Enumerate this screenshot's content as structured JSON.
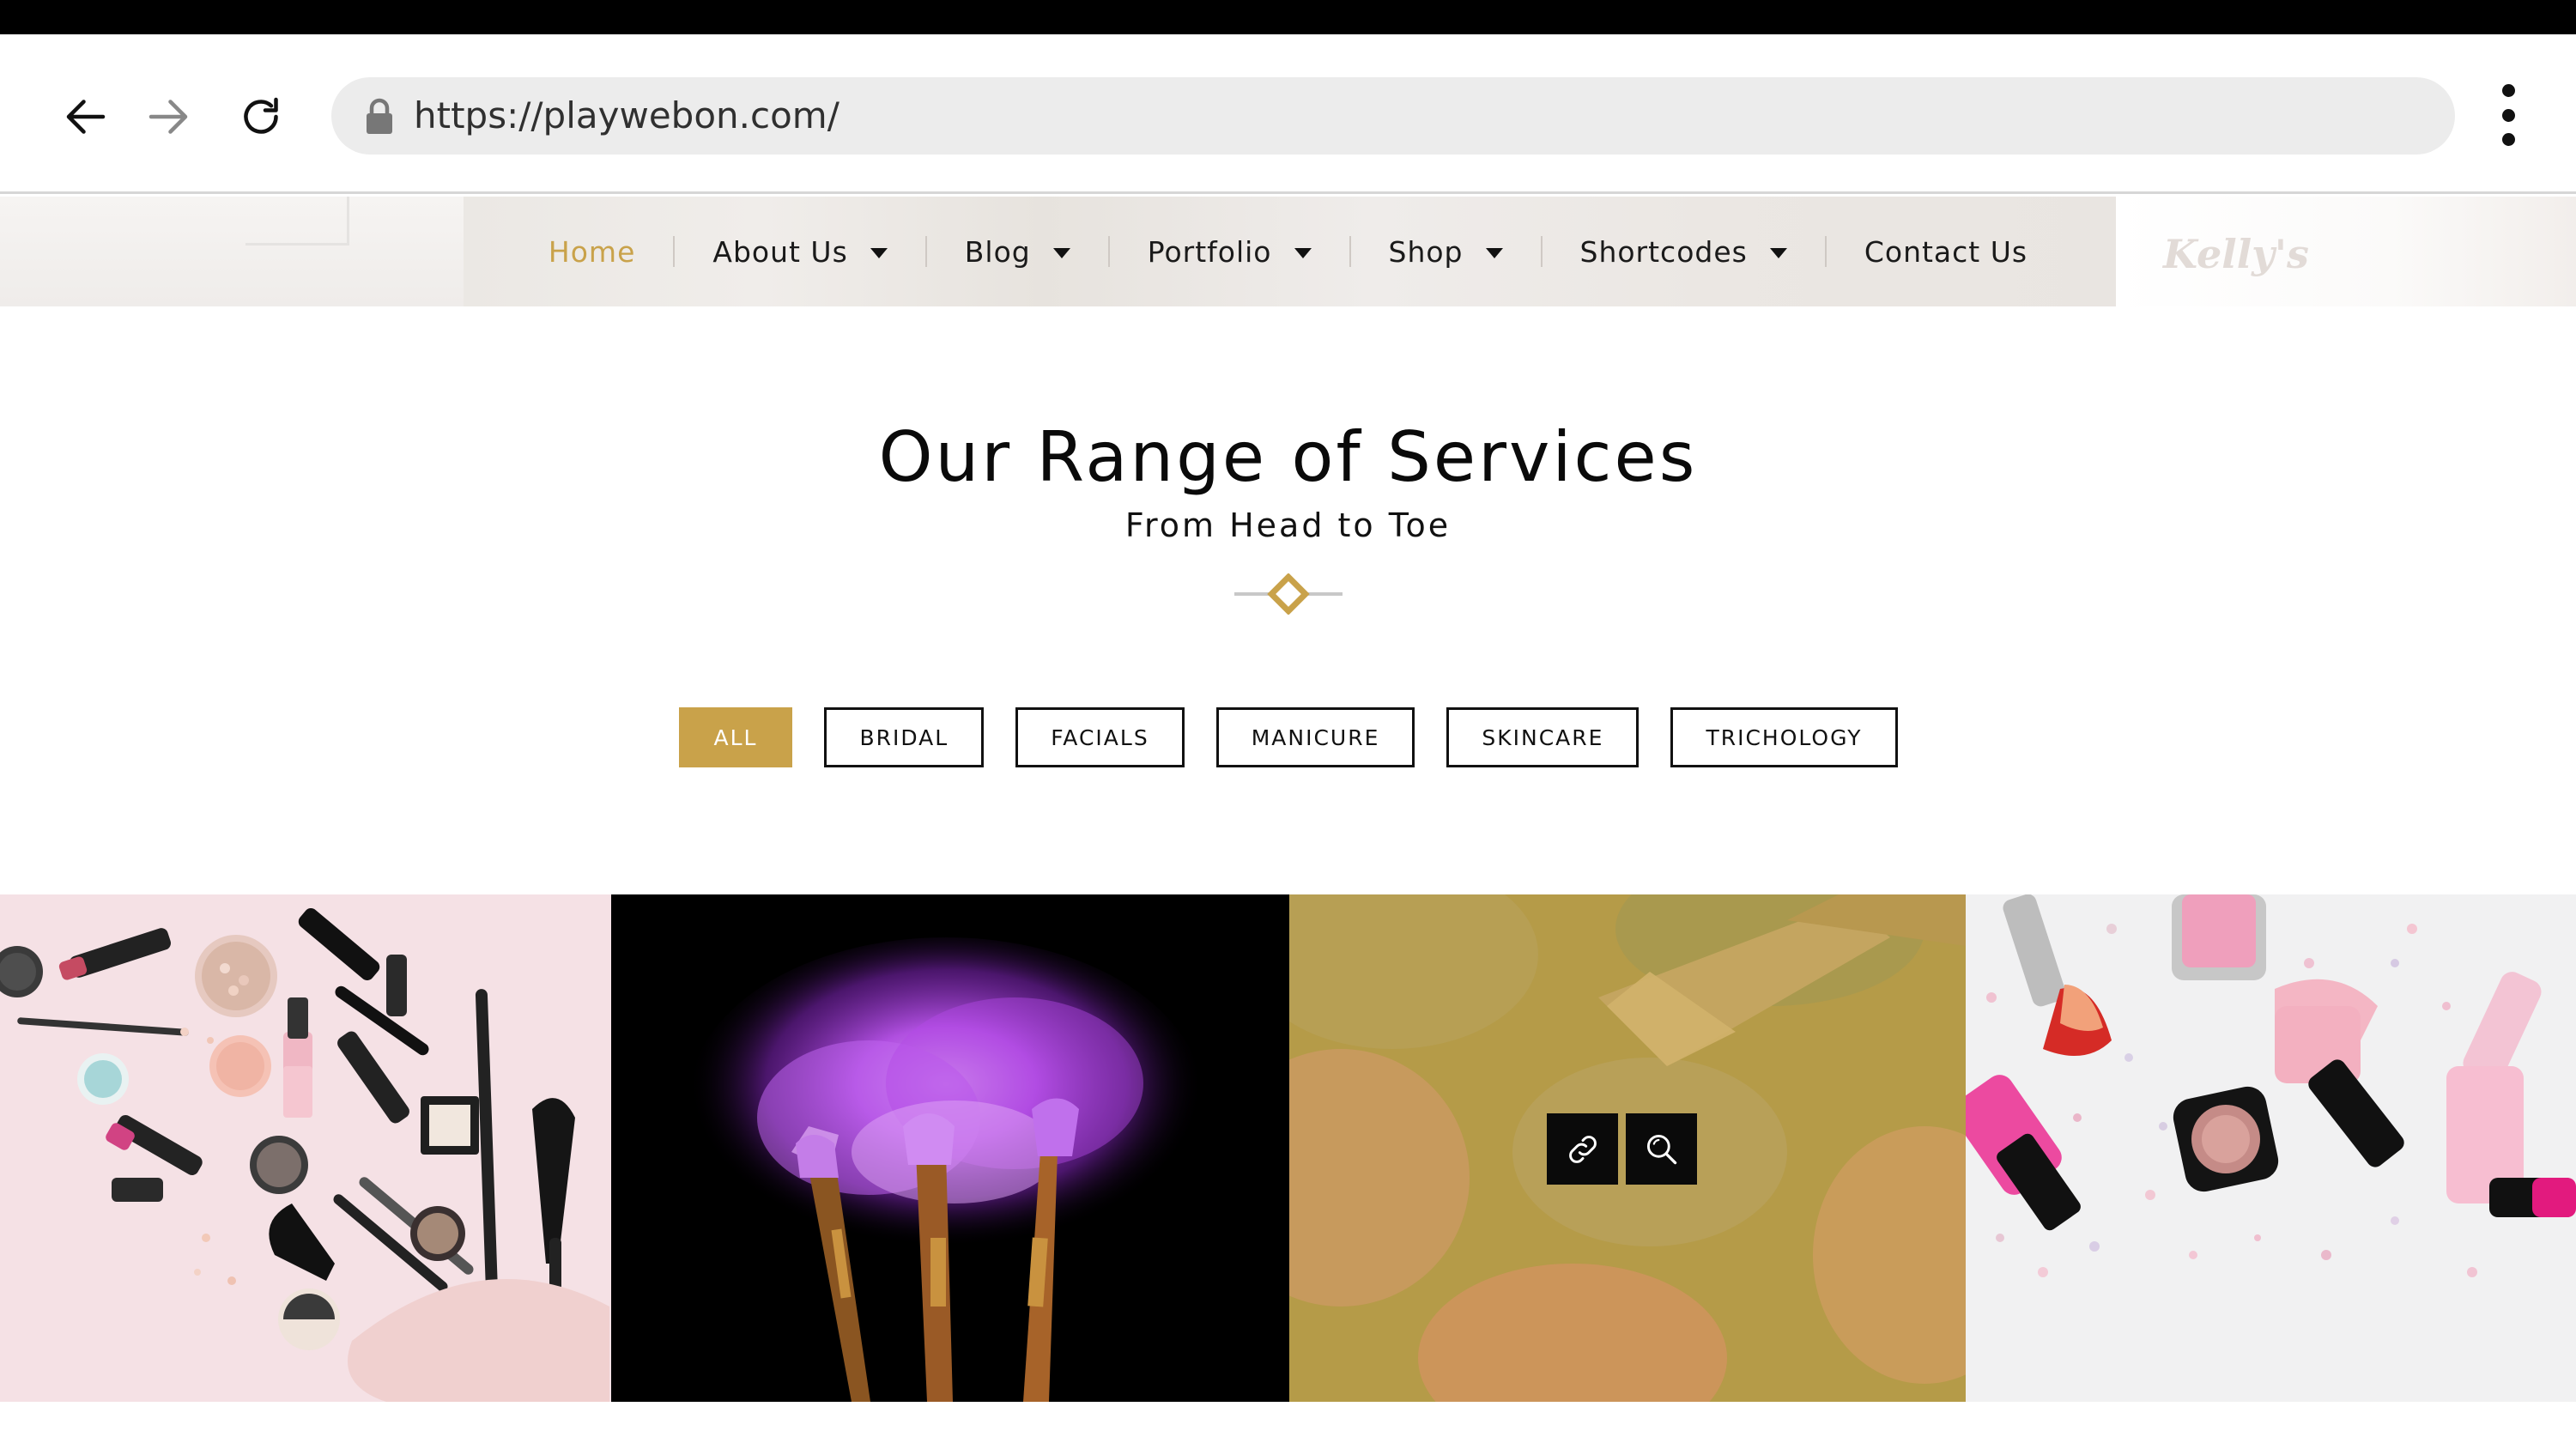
{
  "browser": {
    "url": "https://playwebon.com/",
    "icons": [
      "back-arrow-icon",
      "forward-arrow-icon",
      "reload-icon",
      "lock-icon",
      "more-vert-icon"
    ]
  },
  "header": {
    "logo_text": "Kelly's",
    "nav": [
      {
        "label": "Home",
        "active": true,
        "dropdown": false
      },
      {
        "label": "About Us",
        "active": false,
        "dropdown": true
      },
      {
        "label": "Blog",
        "active": false,
        "dropdown": true
      },
      {
        "label": "Portfolio",
        "active": false,
        "dropdown": true
      },
      {
        "label": "Shop",
        "active": false,
        "dropdown": true
      },
      {
        "label": "Shortcodes",
        "active": false,
        "dropdown": true
      },
      {
        "label": "Contact Us",
        "active": false,
        "dropdown": false
      }
    ]
  },
  "section": {
    "title": "Our Range of Services",
    "subtitle": "From Head to Toe"
  },
  "filters": [
    "ALL",
    "BRIDAL",
    "FACIALS",
    "MANICURE",
    "SKINCARE",
    "TRICHOLOGY"
  ],
  "gallery": {
    "tiles": [
      "makeup-flatlay",
      "purple-powder-brushes",
      "eyeshadow-palette-brush",
      "pink-cosmetics"
    ],
    "overlay_icons": [
      "link-icon",
      "search-icon"
    ]
  },
  "colors": {
    "accent": "#c9a24a",
    "text": "#111111"
  }
}
